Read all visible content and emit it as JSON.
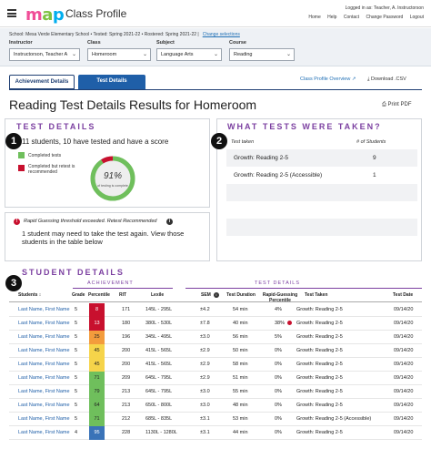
{
  "header": {
    "app_title": "Class Profile",
    "logged_in": "Logged in as: Teacher, A. Instructorson",
    "links": [
      "Home",
      "Help",
      "Contact",
      "Change Password",
      "Logout"
    ]
  },
  "context": {
    "summary": "School: Mesa Verde Elementary School  •  Tested: Spring 2021-22  •  Rostered: Spring 2021-22  |",
    "change_link": "Change selections",
    "instructor_label": "Instructor",
    "instructor_value": "Instructorson, Teacher A",
    "class_label": "Class",
    "class_value": "Homeroom",
    "subject_label": "Subject",
    "subject_value": "Language Arts",
    "course_label": "Course",
    "course_value": "Reading"
  },
  "tabs": {
    "achievement": "Achievement Details",
    "test": "Test Details"
  },
  "actions": {
    "overview": "Class Profile Overview",
    "download": "Download .CSV",
    "print": "Print PDF"
  },
  "page_title": "Reading Test Details Results for Homeroom",
  "test_details": {
    "title": "TEST DETAILS",
    "badge": "1",
    "summary": "11 students, 10 have tested and have a score",
    "legend_completed": "Completed tests",
    "legend_retest": "Completed but retest is recommended",
    "gauge_pct": "91%",
    "gauge_sub": "of testing is complete",
    "gauge_fraction": 0.91,
    "retest_fraction": 0.09
  },
  "tests_taken": {
    "title": "WHAT TESTS WERE TAKEN?",
    "badge": "2",
    "col_test": "Test taken",
    "col_count": "# of Students",
    "rows": [
      {
        "name": "Growth: Reading 2-5",
        "count": "9"
      },
      {
        "name": "Growth: Reading 2-5 (Accessible)",
        "count": "1"
      }
    ]
  },
  "rapid_guessing": {
    "icon": "!",
    "label": "Rapid Guessing threshold exceeded. Retest Recommended",
    "message": "1 student may need to take the test again. View those students in the table below"
  },
  "student_details": {
    "title": "STUDENT DETAILS",
    "badge": "3",
    "group_achievement": "ACHIEVEMENT",
    "group_test": "TEST DETAILS",
    "headers": {
      "students": "Students",
      "grade": "Grade",
      "percentile": "Percentile",
      "rit": "RIT",
      "lexile": "Lexile",
      "sem": "SEM",
      "duration": "Test Duration",
      "rapid": "Rapid-Guessing Percentile",
      "taken": "Test Taken",
      "date": "Test Date"
    },
    "rows": [
      {
        "name": "Last Name, First Name",
        "grade": "5",
        "pct": "8",
        "color": "#c8102e",
        "tc": "#fff",
        "rit": "171",
        "lexile": "145L - 295L",
        "sem": "±4.2",
        "dur": "54 min",
        "rg": "4%",
        "flag": false,
        "test": "Growth: Reading 2-5",
        "date": "09/14/20"
      },
      {
        "name": "Last Name, First Name",
        "grade": "5",
        "pct": "13",
        "color": "#c8102e",
        "tc": "#fff",
        "rit": "180",
        "lexile": "380L - 530L",
        "sem": "±7.8",
        "dur": "40 min",
        "rg": "38%",
        "flag": true,
        "test": "Growth: Reading 2-5",
        "date": "09/14/20"
      },
      {
        "name": "Last Name, First Name",
        "grade": "5",
        "pct": "25",
        "color": "#f39c3c",
        "tc": "#222",
        "rit": "196",
        "lexile": "345L - 495L",
        "sem": "±3.0",
        "dur": "56 min",
        "rg": "5%",
        "flag": false,
        "test": "Growth: Reading 2-5",
        "date": "09/14/20"
      },
      {
        "name": "Last Name, First Name",
        "grade": "5",
        "pct": "45",
        "color": "#f6d44a",
        "tc": "#222",
        "rit": "200",
        "lexile": "415L - 565L",
        "sem": "±2.9",
        "dur": "50 min",
        "rg": "0%",
        "flag": false,
        "test": "Growth: Reading 2-5",
        "date": "09/14/20"
      },
      {
        "name": "Last Name, First Name",
        "grade": "5",
        "pct": "45",
        "color": "#f6d44a",
        "tc": "#222",
        "rit": "200",
        "lexile": "415L - 565L",
        "sem": "±2.9",
        "dur": "58 min",
        "rg": "0%",
        "flag": false,
        "test": "Growth: Reading 2-5",
        "date": "09/14/20"
      },
      {
        "name": "Last Name, First Name",
        "grade": "5",
        "pct": "71",
        "color": "#6fbf5c",
        "tc": "#222",
        "rit": "209",
        "lexile": "645L - 795L",
        "sem": "±2.9",
        "dur": "51 min",
        "rg": "0%",
        "flag": false,
        "test": "Growth: Reading 2-5",
        "date": "09/14/20"
      },
      {
        "name": "Last Name, First Name",
        "grade": "5",
        "pct": "79",
        "color": "#6fbf5c",
        "tc": "#222",
        "rit": "213",
        "lexile": "645L - 795L",
        "sem": "±3.0",
        "dur": "55 min",
        "rg": "0%",
        "flag": false,
        "test": "Growth: Reading 2-5",
        "date": "09/14/20"
      },
      {
        "name": "Last Name, First Name",
        "grade": "5",
        "pct": "64",
        "color": "#6fbf5c",
        "tc": "#222",
        "rit": "213",
        "lexile": "650L - 800L",
        "sem": "±3.0",
        "dur": "48 min",
        "rg": "0%",
        "flag": false,
        "test": "Growth: Reading 2-5",
        "date": "09/14/20"
      },
      {
        "name": "Last Name, First Name",
        "grade": "5",
        "pct": "71",
        "color": "#6fbf5c",
        "tc": "#222",
        "rit": "212",
        "lexile": "685L - 835L",
        "sem": "±3.1",
        "dur": "53 min",
        "rg": "0%",
        "flag": false,
        "test": "Growth: Reading 2-5 (Accessible)",
        "date": "09/14/20"
      },
      {
        "name": "Last Name, First Name",
        "grade": "4",
        "pct": "95",
        "color": "#3a73b8",
        "tc": "#fff",
        "rit": "228",
        "lexile": "1130L - 1280L",
        "sem": "±3.1",
        "dur": "44 min",
        "rg": "0%",
        "flag": false,
        "test": "Growth: Reading 2-5",
        "date": "09/14/20"
      }
    ]
  }
}
